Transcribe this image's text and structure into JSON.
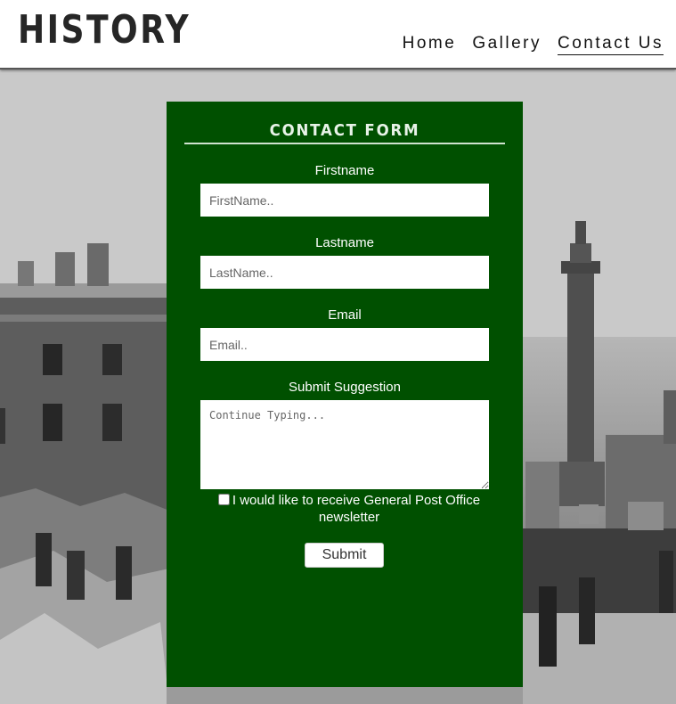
{
  "header": {
    "logo": "HISTORY",
    "nav": [
      {
        "label": "Home"
      },
      {
        "label": "Gallery"
      },
      {
        "label": "Contact Us"
      }
    ]
  },
  "form": {
    "title": "CONTACT FORM",
    "firstname": {
      "label": "Firstname",
      "placeholder": "FirstName.."
    },
    "lastname": {
      "label": "Lastname",
      "placeholder": "LastName.."
    },
    "email": {
      "label": "Email",
      "placeholder": "Email.."
    },
    "suggestion": {
      "label": "Submit Suggestion",
      "placeholder": "Continue Typing..."
    },
    "newsletter_label": "I would like to receive General Post Office newsletter",
    "submit_label": "Submit"
  },
  "colors": {
    "panel": "#005000",
    "header_bg": "#ffffff"
  }
}
